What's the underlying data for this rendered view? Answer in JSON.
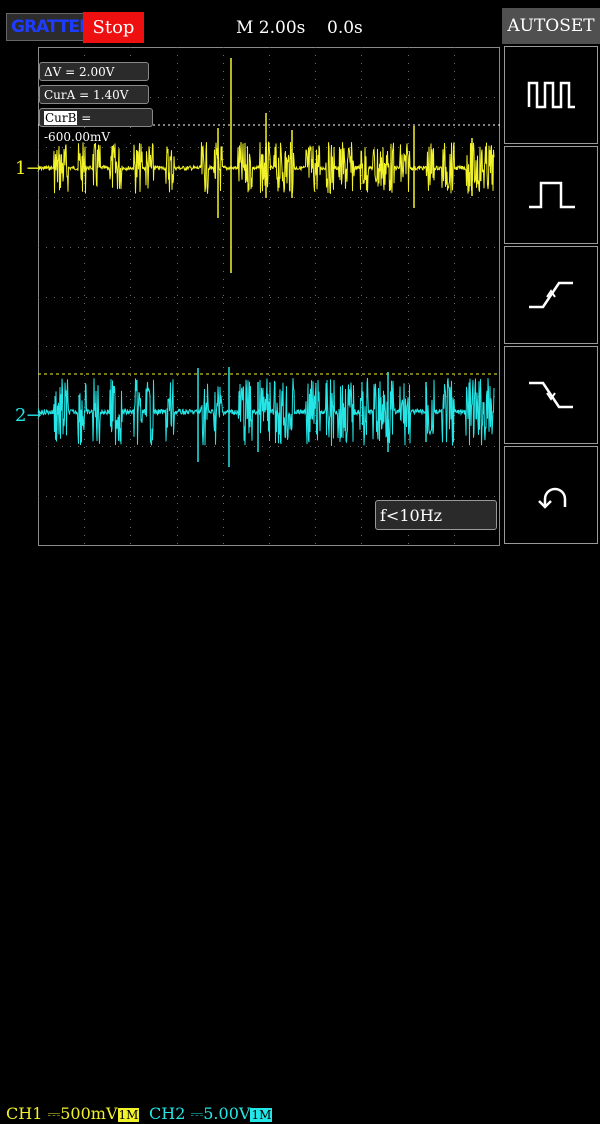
{
  "header": {
    "logo_text": "GRATTEN",
    "run_state_label": "Stop",
    "timebase": "M 2.00s",
    "trigger_position": "0.0s"
  },
  "cursor_readouts": [
    {
      "label": "ΔV",
      "value": "= 2.00V"
    },
    {
      "label": "CurA",
      "value": "= 1.40V"
    },
    {
      "label": "CurB",
      "value": "= -600.00mV"
    }
  ],
  "trigger_readout": "f<10Hz",
  "channel_markers": {
    "ch1": "1",
    "ch2": "2"
  },
  "side_menu": {
    "title": "AUTOSET",
    "buttons": [
      {
        "name": "multi-period",
        "icon": "square-wave-icon"
      },
      {
        "name": "single-period",
        "icon": "single-pulse-icon"
      },
      {
        "name": "rising-edge",
        "icon": "rising-edge-icon"
      },
      {
        "name": "falling-edge",
        "icon": "falling-edge-icon"
      },
      {
        "name": "undo",
        "icon": "undo-icon"
      }
    ]
  },
  "status_bar": {
    "ch1_label": "CH1",
    "ch1_coupling": "DC",
    "ch1_scale": "500mV",
    "ch1_impedance": "1M",
    "ch2_label": "CH2",
    "ch2_coupling": "DC",
    "ch2_scale": "5.00V",
    "ch2_impedance": "1M"
  },
  "colors": {
    "ch1": "#f2f22a",
    "ch2": "#25e6e6",
    "stop_bg": "#ee1010",
    "logo": "#1e3cff",
    "grid": "#6a6a6a"
  }
}
